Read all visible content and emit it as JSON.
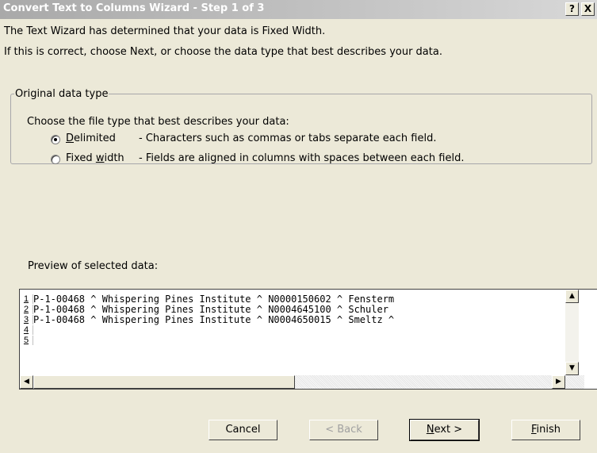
{
  "window": {
    "title": "Convert Text to Columns Wizard - Step 1 of 3",
    "help_label": "?",
    "close_label": "X"
  },
  "intro": {
    "line1": "The Text Wizard has determined that your data is Fixed Width.",
    "line2": "If this is correct, choose Next, or choose the data type that best describes your data."
  },
  "original_data_type": {
    "legend": "Original data type",
    "prompt": "Choose the file type that best describes your data:",
    "options": [
      {
        "label": "Delimited",
        "description": "- Characters such as commas or tabs separate each field.",
        "selected": true
      },
      {
        "label": "Fixed width",
        "description": "- Fields are aligned in columns with spaces between each field.",
        "selected": false
      }
    ]
  },
  "preview": {
    "label": "Preview of selected data:",
    "rows": [
      {
        "num": "1",
        "text": "P-1-00468 ^ Whispering Pines Institute ^ N0000150602 ^ Fensterm"
      },
      {
        "num": "2",
        "text": "P-1-00468 ^ Whispering Pines Institute ^ N0004645100 ^ Schuler "
      },
      {
        "num": "3",
        "text": "P-1-00468 ^ Whispering Pines Institute ^ N0004650015 ^ Smeltz ^"
      },
      {
        "num": "4",
        "text": ""
      },
      {
        "num": "5",
        "text": ""
      }
    ]
  },
  "buttons": {
    "cancel": "Cancel",
    "back": "< Back",
    "next": "Next >",
    "finish": "Finish"
  }
}
